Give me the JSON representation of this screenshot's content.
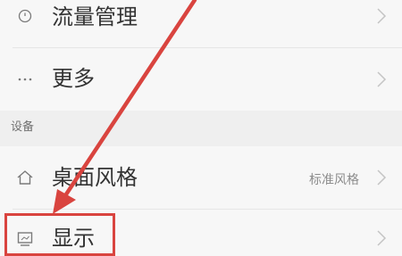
{
  "rows": [
    {
      "label": "流量管理",
      "icon": "traffic-icon"
    },
    {
      "label": "更多",
      "icon": "more-dots-icon"
    }
  ],
  "section": {
    "title": "设备"
  },
  "device_rows": [
    {
      "label": "桌面风格",
      "value": "标准风格",
      "icon": "home-icon"
    },
    {
      "label": "显示",
      "icon": "display-icon"
    }
  ],
  "annotation": {
    "color": "#d9443f"
  }
}
